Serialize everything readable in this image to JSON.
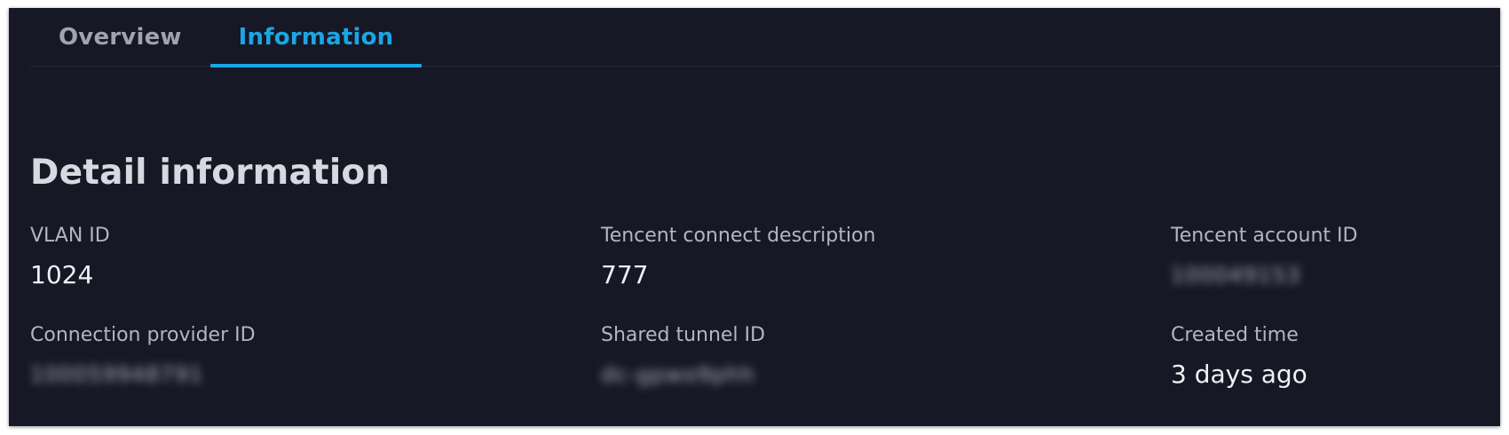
{
  "tabs": [
    {
      "label": "Overview",
      "active": false
    },
    {
      "label": "Information",
      "active": true
    }
  ],
  "section": {
    "title": "Detail information"
  },
  "fields": {
    "vlan_id": {
      "label": "VLAN ID",
      "value": "1024"
    },
    "tencent_connect_description": {
      "label": "Tencent connect description",
      "value": "777"
    },
    "tencent_account_id": {
      "label": "Tencent account ID",
      "value": "100049153"
    },
    "connection_provider_id": {
      "label": "Connection provider ID",
      "value": "100059948791"
    },
    "shared_tunnel_id": {
      "label": "Shared tunnel ID",
      "value": "dc-gpwo9phh"
    },
    "created_time": {
      "label": "Created time",
      "value": "3 days ago"
    }
  },
  "colors": {
    "background": "#161825",
    "accent": "#1aa6e4",
    "tab_inactive": "#9fa3b2",
    "label": "#b2b6c4",
    "value": "#eef0f5"
  }
}
